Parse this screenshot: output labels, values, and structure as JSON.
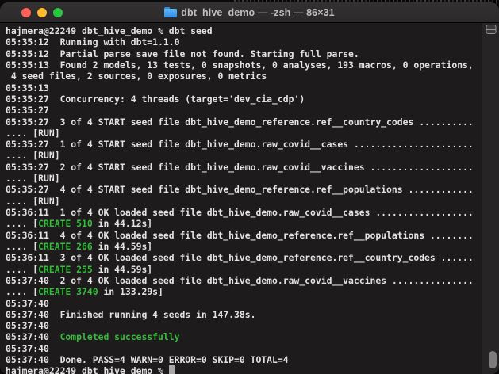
{
  "window": {
    "title": "dbt_hive_demo — -zsh — 86×31",
    "traffic_lights": {
      "close_color": "#ff5f57",
      "minimize_color": "#febc2e",
      "zoom_color": "#28c840"
    },
    "folder_icon_color": "#3b99fc"
  },
  "terminal": {
    "colors": {
      "background": "#1d1b1c",
      "foreground": "#e4e2e2",
      "green": "#34bd3a",
      "cursor": "#a9a7a7"
    },
    "columns": 86,
    "rows": 31,
    "lines": [
      {
        "segments": [
          {
            "t": "hajmera@22249 dbt_hive_demo % dbt seed",
            "c": "fg"
          }
        ]
      },
      {
        "segments": [
          {
            "t": "05:35:12  Running with dbt=1.1.0",
            "c": "fg"
          }
        ]
      },
      {
        "segments": [
          {
            "t": "05:35:12  Partial parse save file not found. Starting full parse.",
            "c": "fg"
          }
        ]
      },
      {
        "segments": [
          {
            "t": "05:35:13  Found 2 models, 13 tests, 0 snapshots, 0 analyses, 193 macros, 0 operations,",
            "c": "fg"
          }
        ]
      },
      {
        "segments": [
          {
            "t": " 4 seed files, 2 sources, 0 exposures, 0 metrics",
            "c": "fg"
          }
        ]
      },
      {
        "segments": [
          {
            "t": "05:35:13",
            "c": "fg"
          }
        ]
      },
      {
        "segments": [
          {
            "t": "05:35:27  Concurrency: 4 threads (target='dev_cia_cdp')",
            "c": "fg"
          }
        ]
      },
      {
        "segments": [
          {
            "t": "05:35:27",
            "c": "fg"
          }
        ]
      },
      {
        "segments": [
          {
            "t": "05:35:27  3 of 4 START seed file dbt_hive_demo_reference.ref__country_codes ..........",
            "c": "fg"
          }
        ]
      },
      {
        "segments": [
          {
            "t": ".... [RUN]",
            "c": "fg"
          }
        ]
      },
      {
        "segments": [
          {
            "t": "05:35:27  1 of 4 START seed file dbt_hive_demo.raw_covid__cases ......................",
            "c": "fg"
          }
        ]
      },
      {
        "segments": [
          {
            "t": ".... [RUN]",
            "c": "fg"
          }
        ]
      },
      {
        "segments": [
          {
            "t": "05:35:27  2 of 4 START seed file dbt_hive_demo.raw_covid__vaccines ...................",
            "c": "fg"
          }
        ]
      },
      {
        "segments": [
          {
            "t": ".... [RUN]",
            "c": "fg"
          }
        ]
      },
      {
        "segments": [
          {
            "t": "05:35:27  4 of 4 START seed file dbt_hive_demo_reference.ref__populations ............",
            "c": "fg"
          }
        ]
      },
      {
        "segments": [
          {
            "t": ".... [RUN]",
            "c": "fg"
          }
        ]
      },
      {
        "segments": [
          {
            "t": "05:36:11  1 of 4 OK loaded seed file dbt_hive_demo.raw_covid__cases ..................",
            "c": "fg"
          }
        ]
      },
      {
        "segments": [
          {
            "t": ".... [",
            "c": "fg"
          },
          {
            "t": "CREATE 510",
            "c": "green"
          },
          {
            "t": " in 44.12s]",
            "c": "fg"
          }
        ]
      },
      {
        "segments": [
          {
            "t": "05:36:11  4 of 4 OK loaded seed file dbt_hive_demo_reference.ref__populations ........",
            "c": "fg"
          }
        ]
      },
      {
        "segments": [
          {
            "t": ".... [",
            "c": "fg"
          },
          {
            "t": "CREATE 266",
            "c": "green"
          },
          {
            "t": " in 44.59s]",
            "c": "fg"
          }
        ]
      },
      {
        "segments": [
          {
            "t": "05:36:11  3 of 4 OK loaded seed file dbt_hive_demo_reference.ref__country_codes ......",
            "c": "fg"
          }
        ]
      },
      {
        "segments": [
          {
            "t": ".... [",
            "c": "fg"
          },
          {
            "t": "CREATE 255",
            "c": "green"
          },
          {
            "t": " in 44.59s]",
            "c": "fg"
          }
        ]
      },
      {
        "segments": [
          {
            "t": "05:37:40  2 of 4 OK loaded seed file dbt_hive_demo.raw_covid__vaccines ...............",
            "c": "fg"
          }
        ]
      },
      {
        "segments": [
          {
            "t": ".... [",
            "c": "fg"
          },
          {
            "t": "CREATE 3740",
            "c": "green"
          },
          {
            "t": " in 133.29s]",
            "c": "fg"
          }
        ]
      },
      {
        "segments": [
          {
            "t": "05:37:40",
            "c": "fg"
          }
        ]
      },
      {
        "segments": [
          {
            "t": "05:37:40  Finished running 4 seeds in 147.38s.",
            "c": "fg"
          }
        ]
      },
      {
        "segments": [
          {
            "t": "05:37:40",
            "c": "fg"
          }
        ]
      },
      {
        "segments": [
          {
            "t": "05:37:40  ",
            "c": "fg"
          },
          {
            "t": "Completed successfully",
            "c": "green"
          }
        ]
      },
      {
        "segments": [
          {
            "t": "05:37:40",
            "c": "fg"
          }
        ]
      },
      {
        "segments": [
          {
            "t": "05:37:40  Done. PASS=4 WARN=0 ERROR=0 SKIP=0 TOTAL=4",
            "c": "fg"
          }
        ]
      },
      {
        "segments": [
          {
            "t": "hajmera@22249 dbt_hive_demo % ",
            "c": "fg"
          },
          {
            "t": " ",
            "c": "cursor"
          }
        ]
      }
    ]
  }
}
